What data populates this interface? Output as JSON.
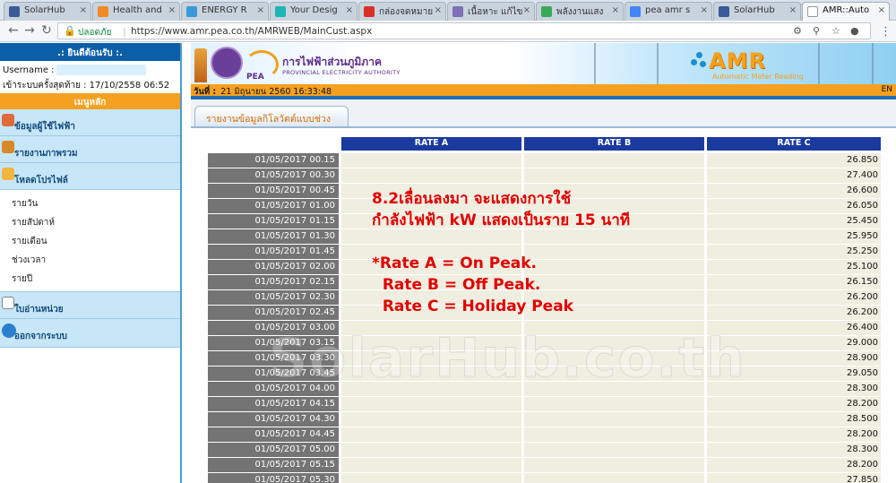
{
  "browser": {
    "tabs": [
      {
        "label": "SolarHub",
        "icon": "facebook-icon",
        "color": "#3b5998"
      },
      {
        "label": "Health and",
        "icon": "orange-site-icon",
        "color": "#f08a24"
      },
      {
        "label": "ENERGY R",
        "icon": "chart-icon",
        "color": "#3a9ad9"
      },
      {
        "label": "Your Desig",
        "icon": "canva-icon",
        "color": "#20b5b5"
      },
      {
        "label": "กล่องจดหมาย",
        "icon": "gmail-icon",
        "color": "#d93025"
      },
      {
        "label": "เนื้อหาะ แก้ไข",
        "icon": "blogger-icon",
        "color": "#7f6fb5"
      },
      {
        "label": "พลังงานแสง",
        "icon": "green-site-icon",
        "color": "#3aa856"
      },
      {
        "label": "pea amr s",
        "icon": "google-icon",
        "color": "#4285f4"
      },
      {
        "label": "SolarHub",
        "icon": "facebook-icon",
        "color": "#3b5998"
      },
      {
        "label": "AMR::Auto",
        "icon": "document-icon",
        "color": "#ffffff",
        "active": true
      }
    ],
    "secure_label": "ปลอดภัย",
    "url": "https://www.amr.pea.co.th/AMRWEB/MainCust.aspx"
  },
  "sidebar": {
    "greeting": ".: ยินดีต้อนรับ :.",
    "username_label": "Username :",
    "last_login": "เข้าระบบครั้งสุดท้าย : 17/10/2558 06:52",
    "main_menu": "เมนูหลัก",
    "menu_usage": "ข้อมูลผู้ใช้ไฟฟ้า",
    "menu_overview": "รายงานภาพรวม",
    "menu_load": "โหลดโปรไฟล์",
    "submenu": [
      "รายวัน",
      "รายสัปดาห์",
      "รายเดือน",
      "ช่วงเวลา",
      "รายปี"
    ],
    "menu_bill": "ใบอ่านหน่วย",
    "menu_logout": "ออกจากระบบ"
  },
  "header": {
    "pea_th": "การไฟฟ้าส่วนภูมิภาค",
    "pea_en": "PROVINCIAL ELECTRICITY AUTHORITY",
    "pea_abbr": "PEA",
    "amr_logo": "AMR",
    "amr_sub": "Automatic Meter Reading",
    "date_label": "วันที่ :",
    "date_value": "21 มิถุนายน 2560  16:33:48",
    "lang": "EN"
  },
  "report": {
    "tab_label": "รายงานข้อมูลกิโลวัตต์แบบช่วงเวลา",
    "columns": [
      "RATE A",
      "RATE B",
      "RATE C"
    ],
    "rows": [
      {
        "time": "01/05/2017 00.15",
        "a": "",
        "b": "",
        "c": "26.850"
      },
      {
        "time": "01/05/2017 00.30",
        "a": "",
        "b": "",
        "c": "27.400"
      },
      {
        "time": "01/05/2017 00.45",
        "a": "",
        "b": "",
        "c": "26.600"
      },
      {
        "time": "01/05/2017 01.00",
        "a": "",
        "b": "",
        "c": "26.050"
      },
      {
        "time": "01/05/2017 01.15",
        "a": "",
        "b": "",
        "c": "25.450"
      },
      {
        "time": "01/05/2017 01.30",
        "a": "",
        "b": "",
        "c": "25.950"
      },
      {
        "time": "01/05/2017 01.45",
        "a": "",
        "b": "",
        "c": "25.250"
      },
      {
        "time": "01/05/2017 02.00",
        "a": "",
        "b": "",
        "c": "25.100"
      },
      {
        "time": "01/05/2017 02.15",
        "a": "",
        "b": "",
        "c": "26.150"
      },
      {
        "time": "01/05/2017 02.30",
        "a": "",
        "b": "",
        "c": "26.200"
      },
      {
        "time": "01/05/2017 02.45",
        "a": "",
        "b": "",
        "c": "26.200"
      },
      {
        "time": "01/05/2017 03.00",
        "a": "",
        "b": "",
        "c": "26.400"
      },
      {
        "time": "01/05/2017 03.15",
        "a": "",
        "b": "",
        "c": "29.000"
      },
      {
        "time": "01/05/2017 03.30",
        "a": "",
        "b": "",
        "c": "28.900"
      },
      {
        "time": "01/05/2017 03.45",
        "a": "",
        "b": "",
        "c": "29.050"
      },
      {
        "time": "01/05/2017 04.00",
        "a": "",
        "b": "",
        "c": "28.300"
      },
      {
        "time": "01/05/2017 04.15",
        "a": "",
        "b": "",
        "c": "28.200"
      },
      {
        "time": "01/05/2017 04.30",
        "a": "",
        "b": "",
        "c": "28.500"
      },
      {
        "time": "01/05/2017 04.45",
        "a": "",
        "b": "",
        "c": "28.200"
      },
      {
        "time": "01/05/2017 05.00",
        "a": "",
        "b": "",
        "c": "28.300"
      },
      {
        "time": "01/05/2017 05.15",
        "a": "",
        "b": "",
        "c": "28.200"
      },
      {
        "time": "01/05/2017 05.30",
        "a": "",
        "b": "",
        "c": "27.850"
      }
    ]
  },
  "annotation": {
    "lines": [
      "8.2เลื่อนลงมา จะแสดงการใช้",
      "กำลังไฟฟ้า kW แสดงเป็นราย 15 นาที",
      "",
      "*Rate A = On Peak.",
      "  Rate B = Off Peak.",
      "  Rate C = Holiday Peak"
    ]
  },
  "watermark": "SolarHub.co.th"
}
